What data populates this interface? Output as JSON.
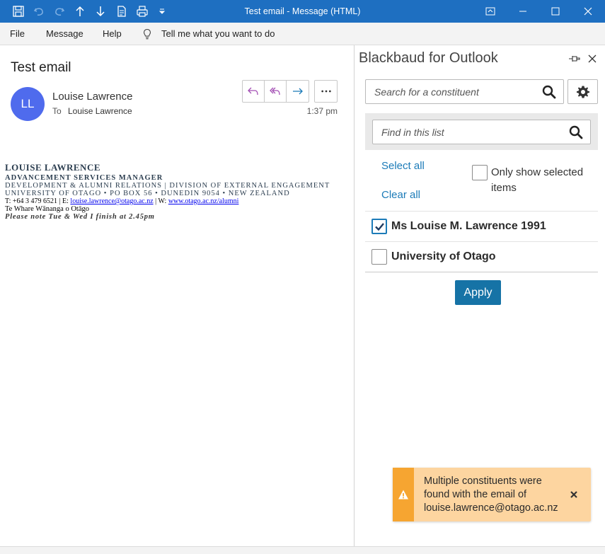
{
  "window": {
    "title": "Test email  -  Message (HTML)"
  },
  "menu": {
    "items": [
      "File",
      "Message",
      "Help"
    ],
    "tell_me": "Tell me what you want to do"
  },
  "message": {
    "subject": "Test email",
    "avatar_initials": "LL",
    "sender": "Louise Lawrence",
    "to_label": "To",
    "to_name": "Louise Lawrence",
    "time": "1:37 pm",
    "more_label": "..."
  },
  "signature": {
    "name": "LOUISE LAWRENCE",
    "role": "ADVANCEMENT SERVICES MANAGER",
    "dept": "DEVELOPMENT & ALUMNI RELATIONS | DIVISION OF EXTERNAL ENGAGEMENT",
    "university": "UNIVERSITY OF OTAGO • PO BOX 56 • DUNEDIN 9054 • NEW ZEALAND",
    "phone_prefix": "T: +64 3 479 6521  | E: ",
    "email": "louise.lawrence@otago.ac.nz",
    "web_prefix": " | W: ",
    "web": "www.otago.ac.nz/alumni",
    "maori": "Te Whare Wānanga o Otāgo",
    "note": "Please note Tue & Wed I finish at 2.45pm"
  },
  "addin": {
    "title": "Blackbaud for Outlook",
    "search_placeholder": "Search for a constituent",
    "find_placeholder": "Find in this list",
    "select_all": "Select all",
    "clear_all": "Clear all",
    "only_selected": "Only show selected items",
    "constituents": [
      {
        "label": "Ms Louise M. Lawrence 1991",
        "checked": true
      },
      {
        "label": "University of Otago",
        "checked": false
      }
    ],
    "apply_label": "Apply"
  },
  "toast": {
    "message": "Multiple constituents were found with the email of louise.lawrence@otago.ac.nz"
  },
  "colors": {
    "titlebar": "#1e6fc1",
    "accent": "#1c7bb8",
    "apply": "#1673a6",
    "avatar": "#4f6bed",
    "warning": "#f6a531",
    "warning_bg": "#fdd5a0"
  }
}
